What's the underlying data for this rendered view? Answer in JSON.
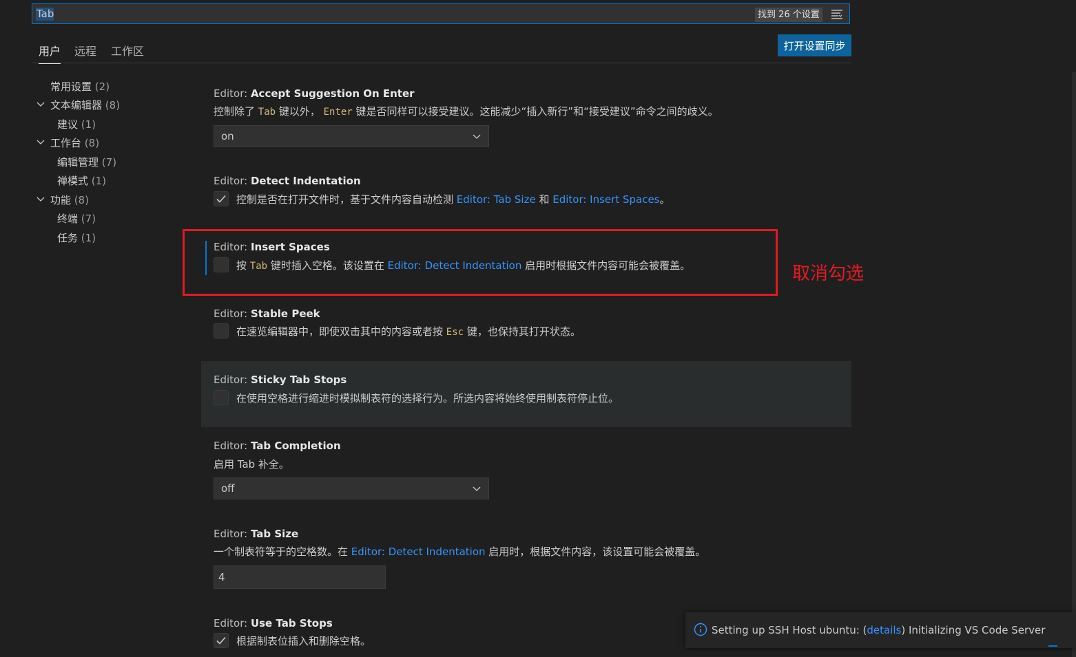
{
  "search": {
    "value": "Tab",
    "result_count": "找到 26 个设置"
  },
  "tabs": [
    {
      "label": "用户"
    },
    {
      "label": "远程"
    },
    {
      "label": "工作区"
    }
  ],
  "sync_button": "打开设置同步",
  "toc": [
    {
      "label": "常用设置",
      "count": "(2)"
    },
    {
      "label": "文本编辑器",
      "count": "(8)"
    },
    {
      "label": "建议",
      "count": "(1)"
    },
    {
      "label": "工作台",
      "count": "(8)"
    },
    {
      "label": "编辑管理",
      "count": "(7)"
    },
    {
      "label": "禅模式",
      "count": "(1)"
    },
    {
      "label": "功能",
      "count": "(8)"
    },
    {
      "label": "终端",
      "count": "(7)"
    },
    {
      "label": "任务",
      "count": "(1)"
    }
  ],
  "settings": {
    "accept_suggestion": {
      "category": "Editor: ",
      "name": "Accept Suggestion On Enter",
      "d1": "控制除了 ",
      "c1": "Tab",
      "d2": " 键以外， ",
      "c2": "Enter",
      "d3": " 键是否同样可以接受建议。这能减少“插入新行”和“接受建议”命令之间的歧义。",
      "value": "on"
    },
    "detect_indentation": {
      "category": "Editor: ",
      "name": "Detect Indentation",
      "d1": "控制是否在打开文件时，基于文件内容自动检测 ",
      "l1": "Editor: Tab Size",
      "d2": " 和 ",
      "l2": "Editor: Insert Spaces",
      "d3": "。",
      "checked": true
    },
    "insert_spaces": {
      "category": "Editor: ",
      "name": "Insert Spaces",
      "d1": "按 ",
      "c1": "Tab",
      "d2": " 键时插入空格。该设置在 ",
      "l1": "Editor: Detect Indentation",
      "d3": " 启用时根据文件内容可能会被覆盖。",
      "checked": false
    },
    "stable_peek": {
      "category": "Editor: ",
      "name": "Stable Peek",
      "d1": "在速览编辑器中，即使双击其中的内容或者按 ",
      "c1": "Esc",
      "d2": " 键，也保持其打开状态。",
      "checked": false
    },
    "sticky_tab_stops": {
      "category": "Editor: ",
      "name": "Sticky Tab Stops",
      "d1": "在使用空格进行缩进时模拟制表符的选择行为。所选内容将始终使用制表符停止位。",
      "checked": false
    },
    "tab_completion": {
      "category": "Editor: ",
      "name": "Tab Completion",
      "d1": "启用 Tab 补全。",
      "value": "off"
    },
    "tab_size": {
      "category": "Editor: ",
      "name": "Tab Size",
      "d1": "一个制表符等于的空格数。在 ",
      "l1": "Editor: Detect Indentation",
      "d2": " 启用时，根据文件内容，该设置可能会被覆盖。",
      "value": "4"
    },
    "use_tab_stops": {
      "category": "Editor: ",
      "name": "Use Tab Stops",
      "d1": "根据制表位插入和删除空格。",
      "checked": true
    }
  },
  "annotation": "取消勾选",
  "notification": {
    "t1": "Setting up SSH Host ubuntu: (",
    "link": "details",
    "t2": ") Initializing VS Code Server"
  },
  "colors": {
    "accent": "#0078d4",
    "annotation_red": "#e01b24",
    "link": "#3794ff"
  }
}
